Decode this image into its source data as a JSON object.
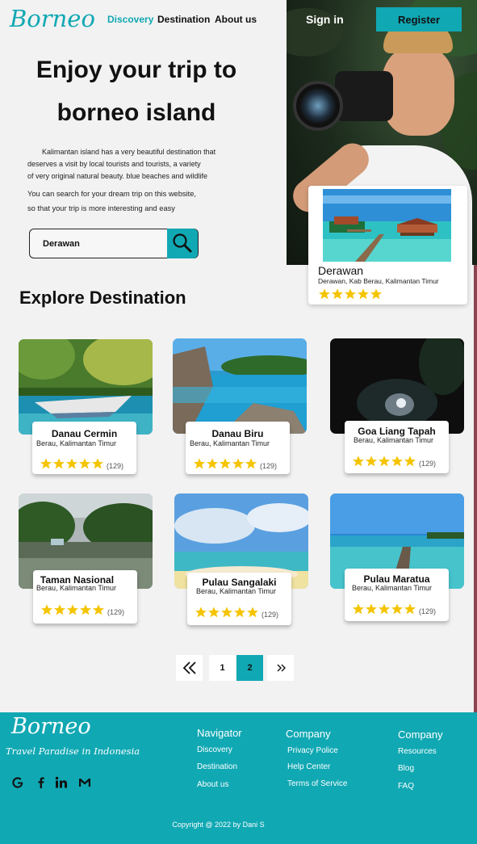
{
  "header": {
    "logo": "Borneo",
    "nav": [
      "Discovery",
      "Destination",
      "About us"
    ],
    "signin": "Sign in",
    "register": "Register"
  },
  "hero": {
    "title_line1": "Enjoy your trip to",
    "title_line2": "borneo island",
    "desc_lines": [
      "Kalimantan island has a very beautiful destination that",
      "deserves a visit by local tourists and tourists, a variety",
      "of very original natural beauty. blue beaches and wildlife"
    ],
    "desc2_lines": [
      "You can search for your dream trip on this website,",
      "so that your trip is more interesting and easy"
    ],
    "search_value": "Derawan"
  },
  "featured": {
    "name": "Derawan",
    "location": "Derawan, Kab  Berau, Kalimantan Timur",
    "rating": 5
  },
  "explore_title": "Explore Destination",
  "destinations": [
    {
      "name": "Danau Cermin",
      "location": "Berau, Kalimantan Timur",
      "rating": 5,
      "reviews": "(129)"
    },
    {
      "name": "Danau Biru",
      "location": "Berau, Kalimantan Timur",
      "rating": 5,
      "reviews": "(129)"
    },
    {
      "name": "Goa Liang Tapah",
      "location": "Berau, Kalimantan Timur",
      "rating": 5,
      "reviews": "(129)"
    },
    {
      "name": "Taman Nasional",
      "location": "Berau, Kalimantan Timur",
      "rating": 5,
      "reviews": "(129)"
    },
    {
      "name": "Pulau Sangalaki",
      "location": "Berau, Kalimantan Timur",
      "rating": 5,
      "reviews": "(129)"
    },
    {
      "name": "Pulau Maratua",
      "location": "Berau, Kalimantan Timur",
      "rating": 5,
      "reviews": "(129)"
    }
  ],
  "pagination": {
    "pages": [
      "1",
      "2"
    ],
    "current": "2"
  },
  "footer": {
    "logo": "Borneo",
    "tagline": "Travel Paradise in Indonesia",
    "social_icons": [
      "google-icon",
      "facebook-icon",
      "linkedin-icon",
      "gmail-icon"
    ],
    "columns": [
      {
        "heading": "Navigator",
        "items": [
          "Discovery",
          "Destination",
          "About us"
        ]
      },
      {
        "heading": "Company",
        "items": [
          "Privacy Police",
          "Help Center",
          "Terms of Service"
        ]
      },
      {
        "heading": "Company",
        "items": [
          "Resources",
          "Blog",
          "FAQ"
        ]
      }
    ],
    "copyright": "Copyright @ 2022 by Dani S"
  },
  "colors": {
    "accent": "#10a8b3",
    "star": "#f5c400"
  }
}
